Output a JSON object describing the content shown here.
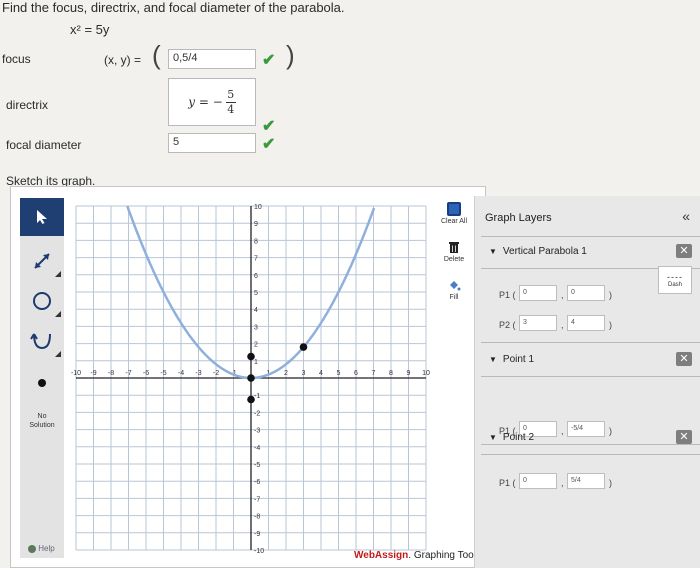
{
  "question": {
    "prompt": "Find the focus, directrix, and focal diameter of the parabola.",
    "equation": "x² = 5y"
  },
  "focus": {
    "label": "focus",
    "coord_label": "(x, y) =",
    "open_paren": "(",
    "close_paren": ")",
    "value": "0,5/4",
    "check": "✔"
  },
  "directrix": {
    "label": "directrix",
    "lhs": "y = −",
    "numerator": "5",
    "denominator": "4",
    "check": "✔"
  },
  "focal_diameter": {
    "label": "focal diameter",
    "value": "5",
    "check": "✔"
  },
  "sketch_prompt": "Sketch its graph.",
  "toolbar": {
    "no_solution": "No Solution",
    "help": "Help"
  },
  "side_actions": {
    "clear_all": "Clear All",
    "delete": "Delete",
    "fill": "Fill"
  },
  "graph": {
    "x_ticks": [
      "-10",
      "-9",
      "-8",
      "-7",
      "-6",
      "-5",
      "-4",
      "-3",
      "-2",
      "-1",
      "1",
      "2",
      "3",
      "4",
      "5",
      "6",
      "7",
      "8",
      "9",
      "10"
    ],
    "y_ticks_pos": [
      "10",
      "9",
      "8",
      "7",
      "6",
      "5",
      "4",
      "3",
      "2",
      "1"
    ],
    "y_ticks_neg": [
      "-1",
      "-2",
      "-3",
      "-4",
      "-5",
      "-6",
      "-7",
      "-8",
      "-9",
      "-10"
    ],
    "xlim": [
      -10,
      10
    ],
    "ylim": [
      -10,
      10
    ],
    "curve_color": "#8fb0dc",
    "points": [
      {
        "x": 0,
        "y": 0
      },
      {
        "x": 3,
        "y": 1.8
      },
      {
        "x": 0,
        "y": -1.25
      },
      {
        "x": 0,
        "y": 1.25
      }
    ]
  },
  "brand": {
    "name": "WebAssign",
    "suffix": ". Graphing Tool"
  },
  "layers": {
    "title": "Graph Layers",
    "collapse": "«",
    "dash_label": "Dash",
    "items": [
      {
        "name": "Vertical Parabola 1",
        "p1_label": "P1 (",
        "p1_x": "0",
        "p1_y": "0",
        "p2_label": "P2 (",
        "p2_x": "3",
        "p2_y": "4"
      },
      {
        "name": "Point 1",
        "p1_label": "P1 (",
        "p1_x": "0",
        "p1_y": "-5/4"
      },
      {
        "name": "Point 2",
        "p1_label": "P1 (",
        "p1_x": "0",
        "p1_y": "5/4"
      }
    ],
    "close_paren": ")",
    "comma": ","
  }
}
